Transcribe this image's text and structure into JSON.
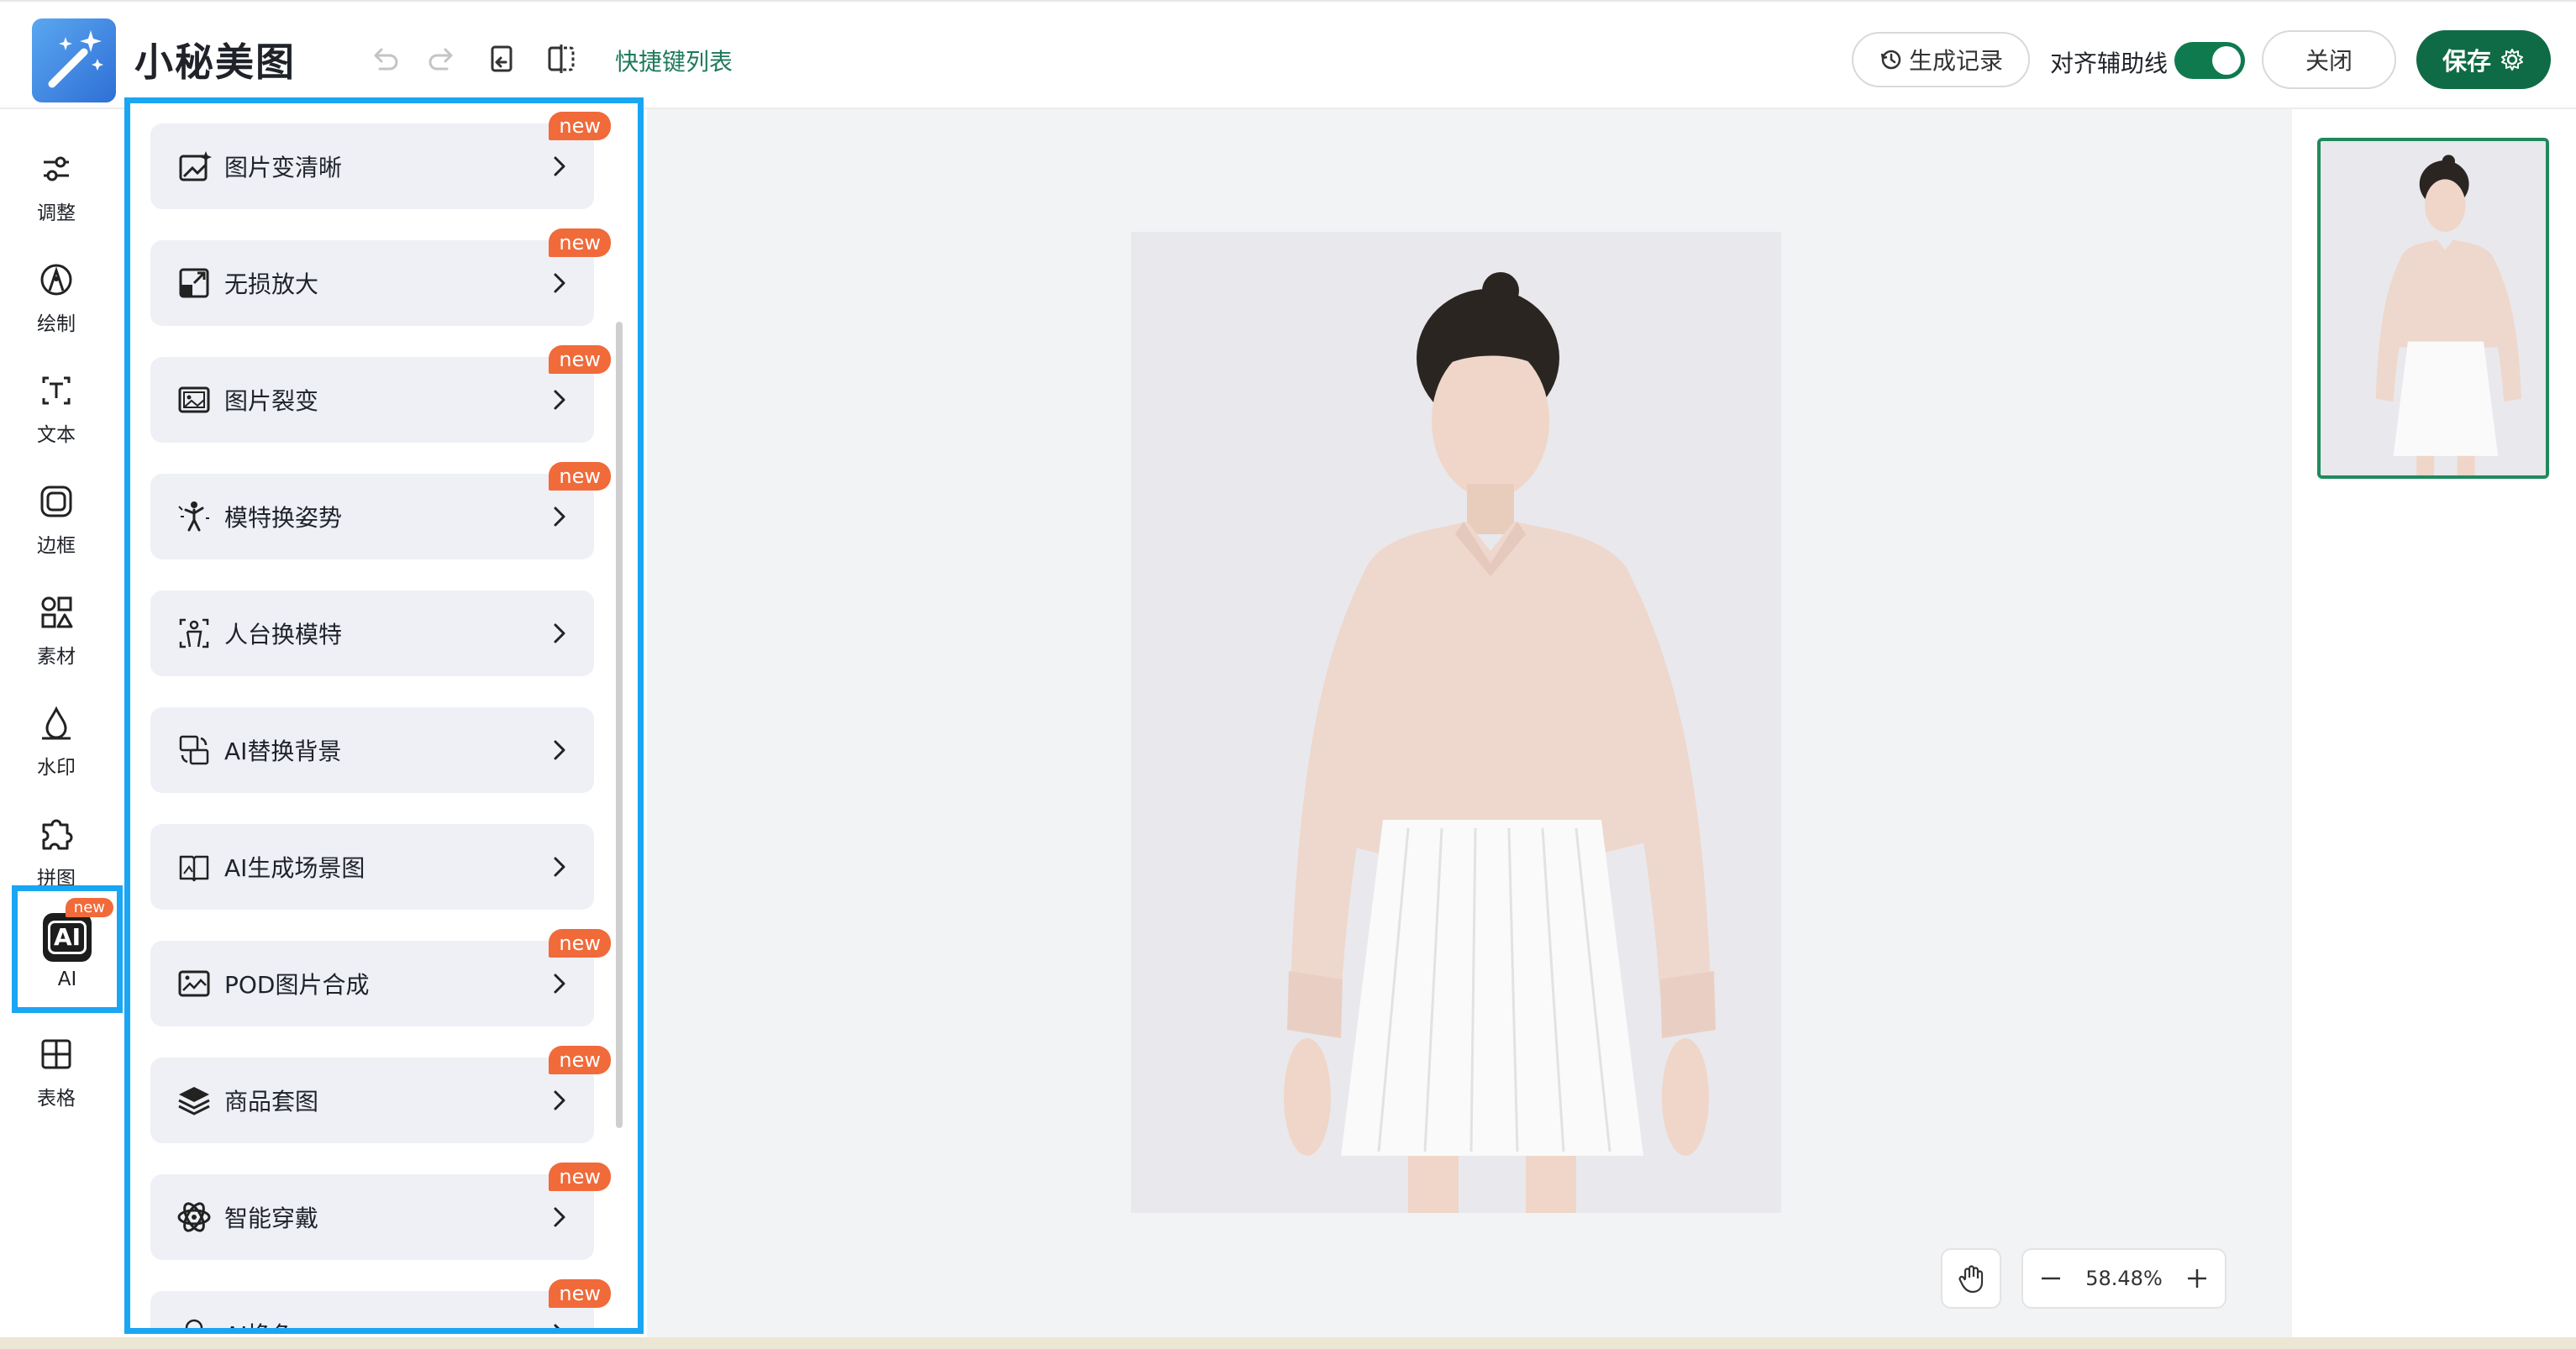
{
  "header": {
    "app_title": "小秘美图",
    "shortcut_link": "快捷键列表",
    "history_button": "生成记录",
    "align_guides_label": "对齐辅助线",
    "align_guides_enabled": true,
    "close_button": "关闭",
    "save_button": "保存"
  },
  "sidebar": {
    "items": [
      {
        "label": "调整",
        "icon": "sliders-icon"
      },
      {
        "label": "绘制",
        "icon": "draw-icon"
      },
      {
        "label": "文本",
        "icon": "text-icon"
      },
      {
        "label": "边框",
        "icon": "frame-icon"
      },
      {
        "label": "素材",
        "icon": "shapes-icon"
      },
      {
        "label": "水印",
        "icon": "watermark-icon"
      },
      {
        "label": "拼图",
        "icon": "puzzle-icon"
      },
      {
        "label": "AI",
        "icon": "ai-icon",
        "badge": "new",
        "active": true
      },
      {
        "label": "表格",
        "icon": "table-icon"
      }
    ]
  },
  "tools": [
    {
      "label": "图片变清晰",
      "icon": "enhance-icon",
      "badge": "new"
    },
    {
      "label": "无损放大",
      "icon": "upscale-icon",
      "badge": "new"
    },
    {
      "label": "图片裂变",
      "icon": "image-variant-icon",
      "badge": "new"
    },
    {
      "label": "模特换姿势",
      "icon": "pose-icon",
      "badge": "new"
    },
    {
      "label": "人台换模特",
      "icon": "mannequin-icon",
      "badge": ""
    },
    {
      "label": "AI替换背景",
      "icon": "background-swap-icon",
      "badge": ""
    },
    {
      "label": "AI生成场景图",
      "icon": "scene-icon",
      "badge": ""
    },
    {
      "label": "POD图片合成",
      "icon": "pod-icon",
      "badge": "new"
    },
    {
      "label": "商品套图",
      "icon": "layers-icon",
      "badge": "new"
    },
    {
      "label": "智能穿戴",
      "icon": "wear-icon",
      "badge": "new"
    },
    {
      "label": "AI换色",
      "icon": "recolor-icon",
      "badge": "new"
    }
  ],
  "canvas": {
    "zoom": "58.48%"
  },
  "colors": {
    "accent_green": "#0f6b45",
    "highlight_blue": "#1aa6f3",
    "new_badge": "#f06a3a"
  }
}
